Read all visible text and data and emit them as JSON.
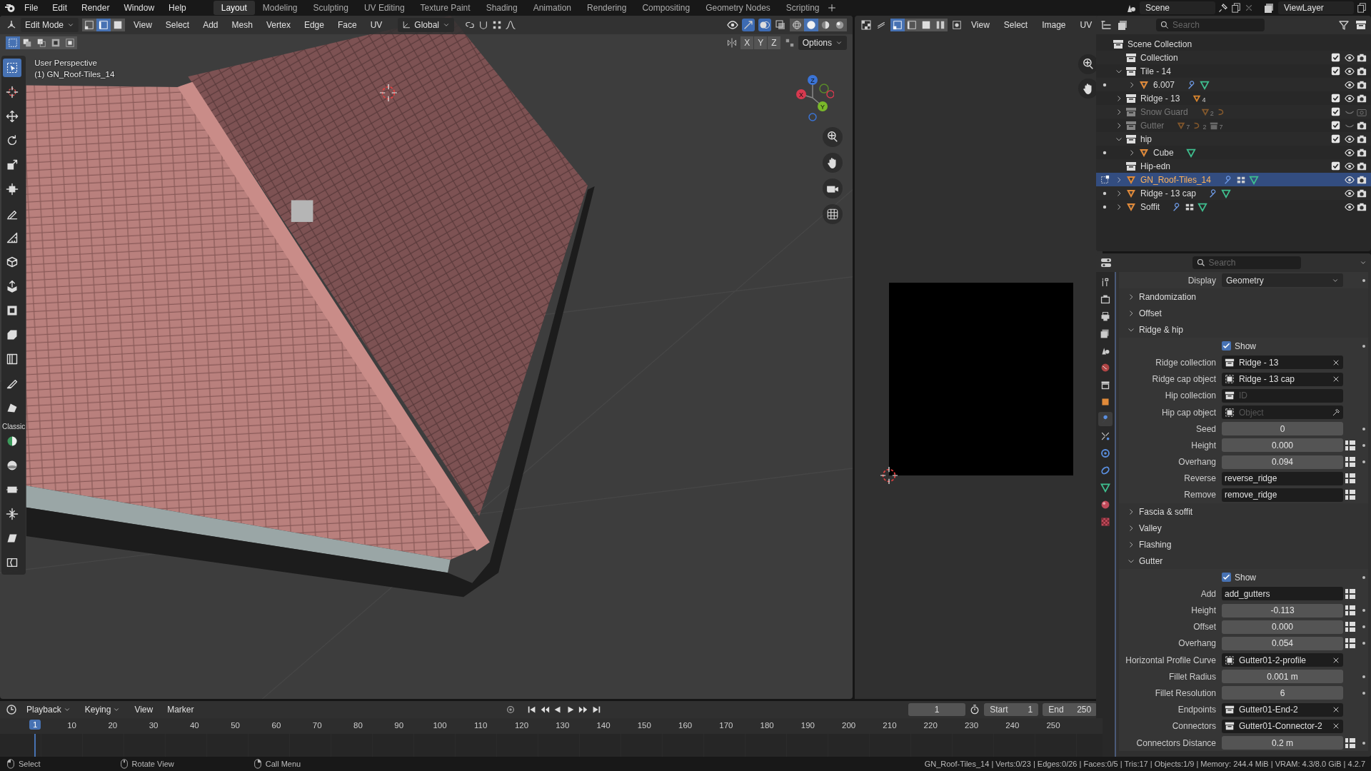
{
  "menu": [
    "File",
    "Edit",
    "Render",
    "Window",
    "Help"
  ],
  "workspaces": [
    {
      "label": "Layout",
      "selected": true
    },
    {
      "label": "Modeling",
      "selected": false
    },
    {
      "label": "Sculpting",
      "selected": false
    },
    {
      "label": "UV Editing",
      "selected": false
    },
    {
      "label": "Texture Paint",
      "selected": false
    },
    {
      "label": "Shading",
      "selected": false
    },
    {
      "label": "Animation",
      "selected": false
    },
    {
      "label": "Rendering",
      "selected": false
    },
    {
      "label": "Compositing",
      "selected": false
    },
    {
      "label": "Geometry Nodes",
      "selected": false
    },
    {
      "label": "Scripting",
      "selected": false
    }
  ],
  "scene": "Scene",
  "view_layer": "ViewLayer",
  "viewport": {
    "mode": "Edit Mode",
    "select_modes": [
      {
        "kind": "vertex",
        "selected": false
      },
      {
        "kind": "edge",
        "selected": true
      },
      {
        "kind": "face",
        "selected": false
      }
    ],
    "menus": [
      "View",
      "Select",
      "Add",
      "Mesh",
      "Vertex",
      "Edge",
      "Face",
      "UV"
    ],
    "orientation": "Global",
    "shading": [
      {
        "kind": "wireframe",
        "selected": false
      },
      {
        "kind": "solid",
        "selected": true
      },
      {
        "kind": "material",
        "selected": false
      },
      {
        "kind": "rendered",
        "selected": false
      }
    ],
    "mirror_axes": [
      "X",
      "Y",
      "Z"
    ],
    "options": "Options",
    "info": [
      "User Perspective",
      "(1) GN_Roof-Tiles_14"
    ],
    "gizmo": [
      "Z",
      "Y",
      "X"
    ],
    "tools": [
      {
        "kind": "select_box",
        "selected": true
      },
      {
        "kind": "cursor",
        "selected": false
      },
      {
        "kind": "move",
        "selected": false
      },
      {
        "kind": "rotate",
        "selected": false
      },
      {
        "kind": "scale",
        "selected": false
      },
      {
        "kind": "transform",
        "selected": false
      },
      {
        "kind": "annotate",
        "selected": false
      },
      {
        "kind": "measure",
        "selected": false
      },
      {
        "kind": "add_cube",
        "selected": false
      },
      {
        "kind": "extrude",
        "selected": false
      },
      {
        "kind": "inset",
        "selected": false
      },
      {
        "kind": "bevel",
        "selected": false
      },
      {
        "kind": "loop_cut",
        "selected": false
      },
      {
        "kind": "knife",
        "selected": false
      },
      {
        "kind": "poly_build",
        "selected": false
      },
      {
        "kind": "caption",
        "text": "Classic"
      },
      {
        "kind": "spin",
        "selected": false
      },
      {
        "kind": "smooth",
        "selected": false
      },
      {
        "kind": "edge_slide",
        "selected": false
      },
      {
        "kind": "shrink",
        "selected": false
      },
      {
        "kind": "shear",
        "selected": false
      },
      {
        "kind": "rip",
        "selected": false
      }
    ]
  },
  "image_editor": {
    "menus": [
      "View",
      "Select",
      "Image",
      "UV"
    ]
  },
  "outliner": {
    "search_placeholder": "Search",
    "root": "Scene Collection",
    "items": [
      {
        "name": "Collection",
        "kind": "collection",
        "selected": false,
        "checked": true,
        "visible": true,
        "renderable": true
      },
      {
        "name": "Tile - 14",
        "kind": "collection",
        "selected": false,
        "expanded": true,
        "checked": true,
        "visible": true,
        "renderable": true,
        "children": [
          {
            "name": "6.007",
            "kind": "object",
            "selected": false,
            "expanded": false,
            "visible": true,
            "renderable": true,
            "badges": [
              {
                "kind": "modifier"
              },
              {
                "kind": "mesh"
              }
            ]
          }
        ]
      },
      {
        "name": "Ridge - 13",
        "kind": "collection",
        "selected": false,
        "expanded": false,
        "checked": true,
        "visible": true,
        "renderable": true,
        "badges": [
          {
            "kind": "mesh_object",
            "count": "4"
          }
        ]
      },
      {
        "name": "Snow Guard",
        "kind": "collection",
        "selected": false,
        "expanded": false,
        "checked": true,
        "visible": false,
        "renderable": false,
        "badges": [
          {
            "kind": "mesh_object",
            "count": "2"
          },
          {
            "kind": "curve"
          }
        ]
      },
      {
        "name": "Gutter",
        "kind": "collection",
        "selected": false,
        "expanded": false,
        "checked": true,
        "visible": false,
        "renderable": true,
        "badges": [
          {
            "kind": "mesh_object",
            "count": "7"
          },
          {
            "kind": "curve",
            "count": "2"
          },
          {
            "kind": "collection",
            "count": "7"
          }
        ]
      },
      {
        "name": "hip",
        "kind": "collection",
        "selected": false,
        "expanded": true,
        "checked": true,
        "visible": true,
        "renderable": true,
        "children": [
          {
            "name": "Cube",
            "kind": "object",
            "selected": false,
            "expanded": false,
            "visible": true,
            "renderable": true,
            "badges": [
              {
                "kind": "mesh"
              }
            ]
          }
        ]
      },
      {
        "name": "Hip-edn",
        "kind": "collection",
        "selected": false,
        "checked": true,
        "visible": true,
        "renderable": true
      },
      {
        "name": "GN_Roof-Tiles_14",
        "kind": "object",
        "selected": true,
        "expanded": false,
        "visible": true,
        "renderable": true,
        "badges": [
          {
            "kind": "modifier"
          },
          {
            "kind": "nodes"
          },
          {
            "kind": "mesh"
          }
        ]
      },
      {
        "name": "Ridge - 13 cap",
        "kind": "object",
        "selected": false,
        "expanded": false,
        "visible": true,
        "renderable": true,
        "badges": [
          {
            "kind": "modifier"
          },
          {
            "kind": "mesh"
          }
        ]
      },
      {
        "name": "Soffit",
        "kind": "object",
        "selected": false,
        "expanded": false,
        "visible": true,
        "renderable": true,
        "badges": [
          {
            "kind": "modifier"
          },
          {
            "kind": "nodes"
          },
          {
            "kind": "mesh"
          }
        ]
      }
    ]
  },
  "properties": {
    "search_placeholder": "Search",
    "tabs": [
      {
        "kind": "tool",
        "selected": false
      },
      {
        "kind": "render",
        "selected": false
      },
      {
        "kind": "output",
        "selected": false
      },
      {
        "kind": "view_layer",
        "selected": false
      },
      {
        "kind": "scene",
        "selected": false
      },
      {
        "kind": "world",
        "selected": false
      },
      {
        "kind": "collection",
        "selected": false
      },
      {
        "kind": "object",
        "selected": false
      },
      {
        "kind": "modifier",
        "selected": true
      },
      {
        "kind": "particles",
        "selected": false
      },
      {
        "kind": "physics",
        "selected": false
      },
      {
        "kind": "constraints",
        "selected": false
      },
      {
        "kind": "data",
        "selected": false
      },
      {
        "kind": "material",
        "selected": false
      },
      {
        "kind": "texture",
        "selected": false
      }
    ],
    "rows": [
      {
        "kind": "dropdown",
        "label": "Display",
        "value": "Geometry",
        "animatable": true
      },
      {
        "kind": "panel",
        "label": "Randomization",
        "expanded": false
      },
      {
        "kind": "panel",
        "label": "Offset",
        "expanded": false
      },
      {
        "kind": "panel",
        "label": "Ridge & hip",
        "expanded": true
      },
      {
        "kind": "checkbox",
        "label": "Show",
        "checked": true,
        "animatable": true
      },
      {
        "kind": "collection_field",
        "label": "Ridge collection",
        "value": "Ridge - 13"
      },
      {
        "kind": "object_field",
        "label": "Ridge cap object",
        "value": "Ridge - 13 cap"
      },
      {
        "kind": "collection_field",
        "label": "Hip collection",
        "placeholder": "ID"
      },
      {
        "kind": "object_field",
        "label": "Hip cap object",
        "placeholder": "Object"
      },
      {
        "kind": "number",
        "label": "Seed",
        "value": "0",
        "animatable": true
      },
      {
        "kind": "number",
        "label": "Height",
        "value": "0.000",
        "attribute_toggle": true,
        "animatable": true
      },
      {
        "kind": "number",
        "label": "Overhang",
        "value": "0.094",
        "attribute_toggle": true,
        "animatable": true
      },
      {
        "kind": "text",
        "label": "Reverse",
        "value": "reverse_ridge",
        "attribute_toggle": true
      },
      {
        "kind": "text",
        "label": "Remove",
        "value": "remove_ridge",
        "attribute_toggle": true
      },
      {
        "kind": "panel",
        "label": "Fascia & soffit",
        "expanded": false
      },
      {
        "kind": "panel",
        "label": "Valley",
        "expanded": false
      },
      {
        "kind": "panel",
        "label": "Flashing",
        "expanded": false
      },
      {
        "kind": "panel",
        "label": "Gutter",
        "expanded": true
      },
      {
        "kind": "checkbox",
        "label": "Show",
        "checked": true,
        "animatable": true
      },
      {
        "kind": "text",
        "label": "Add",
        "value": "add_gutters",
        "attribute_toggle": true
      },
      {
        "kind": "number",
        "label": "Height",
        "value": "-0.113",
        "attribute_toggle": true,
        "animatable": true
      },
      {
        "kind": "number",
        "label": "Offset",
        "value": "0.000",
        "attribute_toggle": true,
        "animatable": true
      },
      {
        "kind": "number",
        "label": "Overhang",
        "value": "0.054",
        "attribute_toggle": true,
        "animatable": true
      },
      {
        "kind": "object_field",
        "label": "Horizontal Profile Curve",
        "value": "Gutter01-2-profile"
      },
      {
        "kind": "number",
        "label": "Fillet Radius",
        "value": "0.001 m",
        "animatable": true
      },
      {
        "kind": "number",
        "label": "Fillet Resolution",
        "value": "6",
        "animatable": true
      },
      {
        "kind": "collection_field",
        "label": "Endpoints",
        "value": "Gutter01-End-2"
      },
      {
        "kind": "collection_field",
        "label": "Connectors",
        "value": "Gutter01-Connector-2"
      },
      {
        "kind": "number",
        "label": "Connectors Distance",
        "value": "0.2 m",
        "attribute_toggle": true,
        "animatable": true
      }
    ]
  },
  "timeline": {
    "menus": [
      "Playback",
      "Keying",
      "View",
      "Marker"
    ],
    "current_frame": "1",
    "start_label": "Start",
    "start": "1",
    "end_label": "End",
    "end": "250",
    "playhead": "1",
    "ruler": [
      "10",
      "20",
      "30",
      "40",
      "50",
      "60",
      "70",
      "80",
      "90",
      "100",
      "110",
      "120",
      "130",
      "140",
      "150",
      "160",
      "170",
      "180",
      "190",
      "200",
      "210",
      "220",
      "230",
      "240",
      "250"
    ]
  },
  "status_bar": {
    "hints": [
      {
        "kind": "left_click",
        "label": "Select"
      },
      {
        "kind": "middle_click",
        "label": "Rotate View"
      },
      {
        "kind": "right_click",
        "label": "Call Menu"
      }
    ],
    "stats": "GN_Roof-Tiles_14 | Verts:0/23 | Edges:0/26 | Faces:0/5 | Tris:17 | Objects:1/9 | Memory: 244.4 MiB | VRAM: 4.3/8.0 GiB | 4.2.7"
  }
}
